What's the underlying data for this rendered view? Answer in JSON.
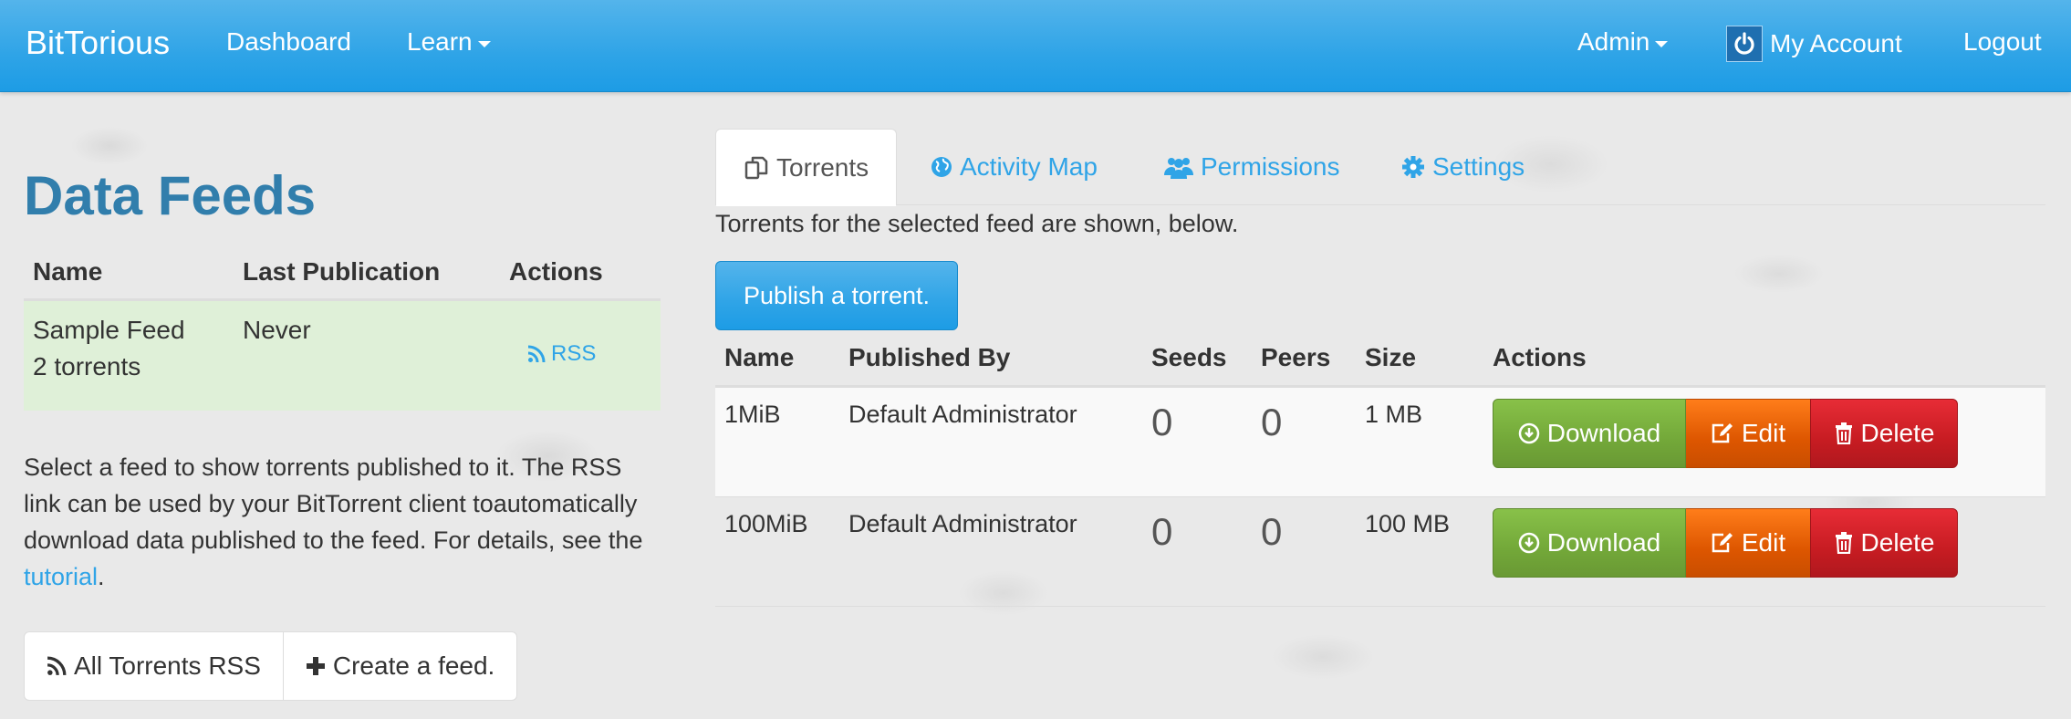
{
  "navbar": {
    "brand": "BitTorious",
    "dashboard": "Dashboard",
    "learn": "Learn",
    "admin": "Admin",
    "my_account": "My Account",
    "logout": "Logout"
  },
  "sidebar": {
    "title": "Data Feeds",
    "columns": [
      "Name",
      "Last Publication",
      "Actions"
    ],
    "feeds": [
      {
        "name": "Sample Feed",
        "count": "2 torrents",
        "last_publication": "Never",
        "action": "RSS"
      }
    ],
    "help_text_before": "Select a feed to show torrents published to it. The RSS link can be used by your BitTorrent client toautomatically download data published to the feed. For details, see the ",
    "help_link": "tutorial",
    "help_text_after": ".",
    "all_rss_button": "All Torrents RSS",
    "create_feed_button": "Create a feed."
  },
  "tabs": [
    {
      "label": "Torrents",
      "icon": "copy-icon"
    },
    {
      "label": "Activity Map",
      "icon": "globe-icon"
    },
    {
      "label": "Permissions",
      "icon": "users-icon"
    },
    {
      "label": "Settings",
      "icon": "gear-icon"
    }
  ],
  "torrents": {
    "description": "Torrents for the selected feed are shown, below.",
    "publish_button": "Publish a torrent.",
    "columns": [
      "Name",
      "Published By",
      "Seeds",
      "Peers",
      "Size",
      "Actions"
    ],
    "rows": [
      {
        "name": "1MiB",
        "published_by": "Default Administrator",
        "seeds": "0",
        "peers": "0",
        "size": "1 MB"
      },
      {
        "name": "100MiB",
        "published_by": "Default Administrator",
        "seeds": "0",
        "peers": "0",
        "size": "100 MB"
      }
    ],
    "actions": {
      "download": "Download",
      "edit": "Edit",
      "delete": "Delete"
    }
  },
  "colors": {
    "primary": "#2fa4e7",
    "title": "#317eac",
    "success": "#73a839",
    "warning": "#dd5600",
    "danger": "#c71c22",
    "selected_row": "#dff0d8"
  }
}
